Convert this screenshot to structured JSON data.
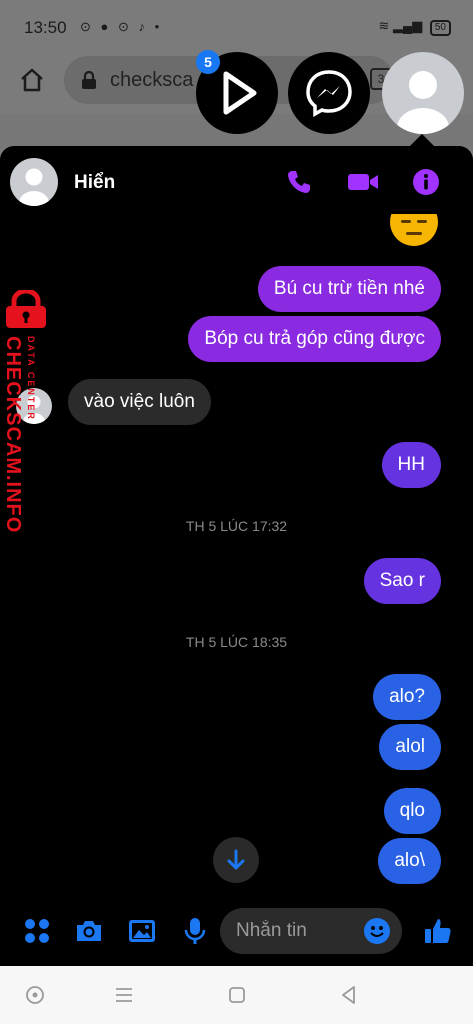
{
  "status_bar": {
    "time": "13:50",
    "battery": "50"
  },
  "browser": {
    "url": "checksca",
    "tab_count": "3"
  },
  "chat_heads": {
    "badge_count": "5"
  },
  "chat": {
    "contact_name": "Hiển",
    "messages": [
      {
        "text": "Bú cu trừ tiền nhé"
      },
      {
        "text": "Bóp cu trả góp cũng được"
      },
      {
        "text": "vào việc luôn"
      },
      {
        "text": "HH"
      },
      {
        "text": "Sao r"
      },
      {
        "text": "alo?"
      },
      {
        "text": "alol"
      },
      {
        "text": "qlo"
      },
      {
        "text": "alo\\"
      }
    ],
    "timestamps": [
      "TH 5 LÚC 17:32",
      "TH 5 LÚC 18:35"
    ]
  },
  "composer": {
    "placeholder": "Nhắn tin"
  },
  "watermark": {
    "main": "CHECKSCAM.INFO",
    "sub": "DATA CENTER"
  },
  "colors": {
    "accent_purple": "#8a2be2",
    "accent_blue": "#2a62e6",
    "icon_purple": "#a033ff",
    "icon_blue": "#1b78f2",
    "watermark_red": "#e4121d"
  }
}
